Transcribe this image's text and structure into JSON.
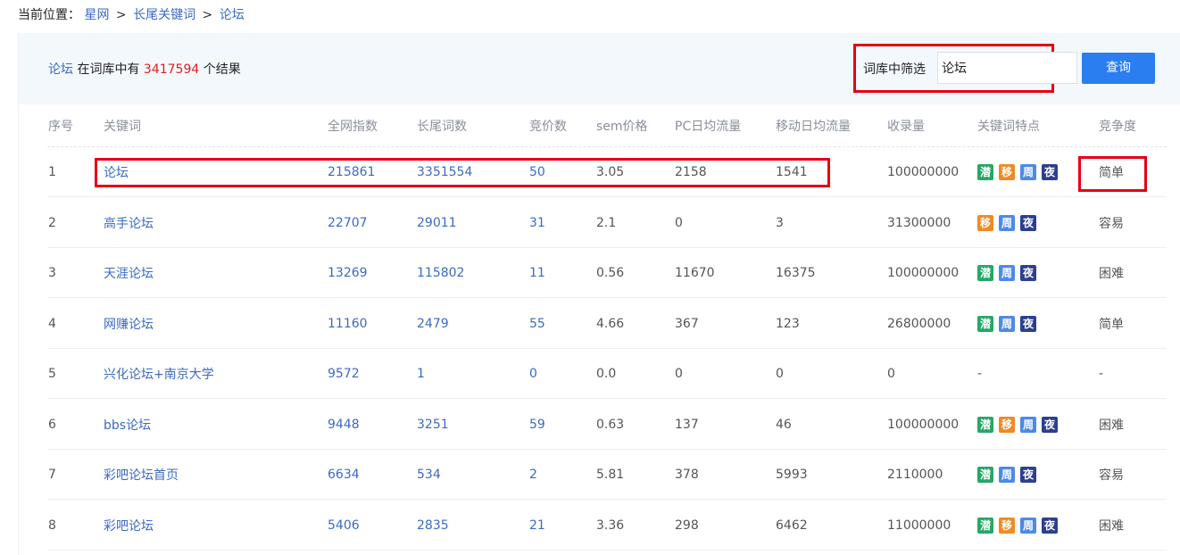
{
  "breadcrumb": {
    "label": "当前位置：",
    "items": [
      "星网",
      "长尾关键词",
      "论坛"
    ],
    "sep": ">"
  },
  "summary": {
    "keyword": "论坛",
    "mid_text": " 在词库中有 ",
    "count": "3417594",
    "suffix": " 个结果"
  },
  "filter": {
    "label": "词库中筛选",
    "value": "论坛",
    "button_label": "查询"
  },
  "table": {
    "headers": [
      "序号",
      "关键词",
      "全网指数",
      "长尾词数",
      "竞价数",
      "sem价格",
      "PC日均流量",
      "移动日均流量",
      "收录量",
      "关键词特点",
      "竞争度"
    ],
    "badge_labels": {
      "qian": "潜",
      "yi": "移",
      "zhou": "周",
      "ye": "夜"
    },
    "badge_colors": {
      "qian": "#25a865",
      "yi": "#f08a24",
      "zhou": "#4d8ae8",
      "ye": "#2d3f8f"
    },
    "rows": [
      {
        "idx": "1",
        "keyword": "论坛",
        "index": "215861",
        "longtail": "3351554",
        "bids": "50",
        "sem": "3.05",
        "pc": "2158",
        "mobile": "1541",
        "indexed": "100000000",
        "features": [
          "qian",
          "yi",
          "zhou",
          "ye"
        ],
        "difficulty": "简单"
      },
      {
        "idx": "2",
        "keyword": "高手论坛",
        "index": "22707",
        "longtail": "29011",
        "bids": "31",
        "sem": "2.1",
        "pc": "0",
        "mobile": "3",
        "indexed": "31300000",
        "features": [
          "yi",
          "zhou",
          "ye"
        ],
        "difficulty": "容易"
      },
      {
        "idx": "3",
        "keyword": "天涯论坛",
        "index": "13269",
        "longtail": "115802",
        "bids": "11",
        "sem": "0.56",
        "pc": "11670",
        "mobile": "16375",
        "indexed": "100000000",
        "features": [
          "qian",
          "zhou",
          "ye"
        ],
        "difficulty": "困难"
      },
      {
        "idx": "4",
        "keyword": "网赚论坛",
        "index": "11160",
        "longtail": "2479",
        "bids": "55",
        "sem": "4.66",
        "pc": "367",
        "mobile": "123",
        "indexed": "26800000",
        "features": [
          "qian",
          "zhou",
          "ye"
        ],
        "difficulty": "简单"
      },
      {
        "idx": "5",
        "keyword": "兴化论坛+南京大学",
        "index": "9572",
        "longtail": "1",
        "bids": "0",
        "sem": "0.0",
        "pc": "0",
        "mobile": "0",
        "indexed": "0",
        "features": [],
        "features_text": "-",
        "difficulty": "-"
      },
      {
        "idx": "6",
        "keyword": "bbs论坛",
        "index": "9448",
        "longtail": "3251",
        "bids": "59",
        "sem": "0.63",
        "pc": "137",
        "mobile": "46",
        "indexed": "100000000",
        "features": [
          "qian",
          "yi",
          "zhou",
          "ye"
        ],
        "difficulty": "困难"
      },
      {
        "idx": "7",
        "keyword": "彩吧论坛首页",
        "index": "6634",
        "longtail": "534",
        "bids": "2",
        "sem": "5.81",
        "pc": "378",
        "mobile": "5993",
        "indexed": "2110000",
        "features": [
          "qian",
          "zhou",
          "ye"
        ],
        "difficulty": "容易"
      },
      {
        "idx": "8",
        "keyword": "彩吧论坛",
        "index": "5406",
        "longtail": "2835",
        "bids": "21",
        "sem": "3.36",
        "pc": "298",
        "mobile": "6462",
        "indexed": "11000000",
        "features": [
          "qian",
          "yi",
          "zhou",
          "ye"
        ],
        "difficulty": "困难"
      }
    ]
  }
}
